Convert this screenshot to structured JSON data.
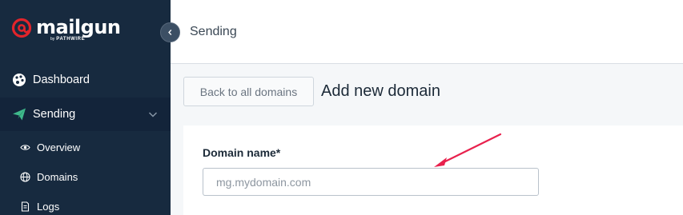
{
  "brand": {
    "name": "mailgun",
    "by": "by",
    "company": "PATHWIRE",
    "accent_color": "#e2242b"
  },
  "sidebar": {
    "items": [
      {
        "label": "Dashboard",
        "icon": "palette-icon"
      },
      {
        "label": "Sending",
        "icon": "paper-plane-icon",
        "expanded": true
      },
      {
        "label": "Overview",
        "icon": "eye-icon"
      },
      {
        "label": "Domains",
        "icon": "globe-icon"
      },
      {
        "label": "Logs",
        "icon": "document-icon"
      }
    ]
  },
  "header": {
    "title": "Sending"
  },
  "main": {
    "back_button": "Back to all domains",
    "title": "Add new domain",
    "form": {
      "domain_label": "Domain name*",
      "domain_placeholder": "mg.mydomain.com",
      "domain_value": ""
    }
  },
  "annotation": {
    "arrow_color": "#e8214d"
  }
}
